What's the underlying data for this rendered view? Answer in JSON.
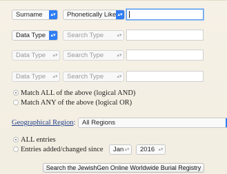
{
  "row1": {
    "field": "Surname",
    "match": "Phonetically Like",
    "value": ""
  },
  "row2": {
    "field": "Data Type",
    "match": "Search Type",
    "value": ""
  },
  "row3": {
    "field": "Data Type",
    "match": "Search Type",
    "value": ""
  },
  "row4": {
    "field": "Data Type",
    "match": "Search Type",
    "value": ""
  },
  "logic": {
    "all": "Match ALL of the above (logical AND)",
    "any": "Match ANY of the above (logical OR)"
  },
  "geo": {
    "label": "Geographical Region",
    "colon": ":",
    "value": "All Regions"
  },
  "entries": {
    "all": "ALL entries",
    "since": "Entries added/changed since",
    "month": "Jan",
    "year": "2016"
  },
  "search_button": "Search the JewishGen Online Worldwide Burial Registry",
  "colors": {
    "accent": "#2f7ef5",
    "panel": "#f3eee2",
    "link": "#1f3f8a"
  },
  "icons": {
    "dropdown": "chevron-updown-icon"
  }
}
